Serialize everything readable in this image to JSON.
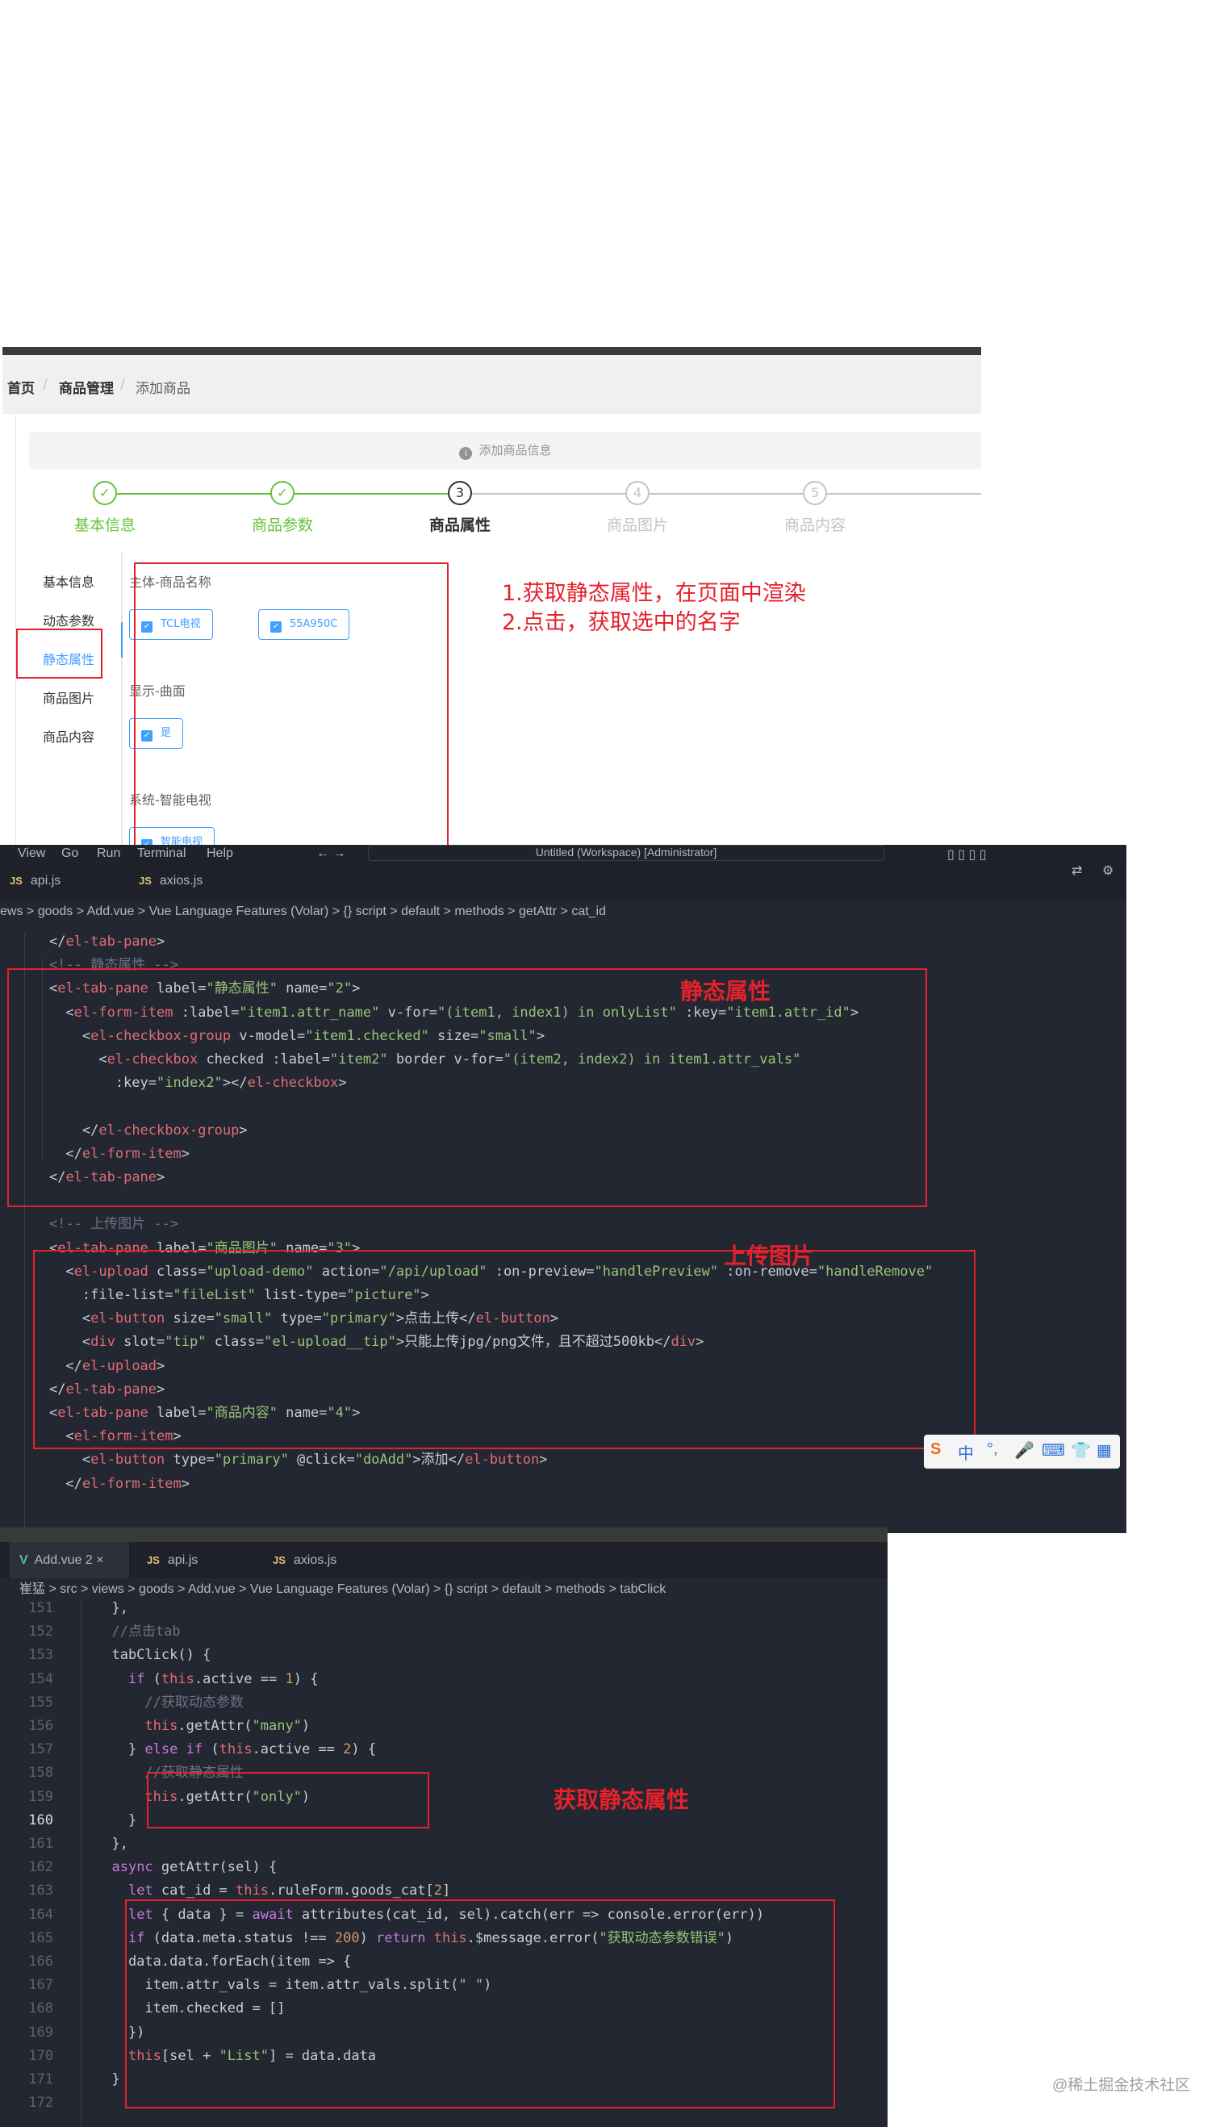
{
  "admin": {
    "breadcrumb": [
      "首页",
      "商品管理",
      "添加商品"
    ],
    "alert": "添加商品信息",
    "steps": [
      {
        "num": "✓",
        "label": "基本信息"
      },
      {
        "num": "✓",
        "label": "商品参数"
      },
      {
        "num": "3",
        "label": "商品属性"
      },
      {
        "num": "4",
        "label": "商品图片"
      },
      {
        "num": "5",
        "label": "商品内容"
      }
    ],
    "side_tabs": [
      "基本信息",
      "动态参数",
      "静态属性",
      "商品图片",
      "商品内容"
    ],
    "groups": [
      {
        "title": "主体-商品名称",
        "options": [
          "TCL电视",
          "55A950C"
        ]
      },
      {
        "title": "显示-曲面",
        "options": [
          "是"
        ]
      },
      {
        "title": "系统-智能电视",
        "options": [
          "智能电视"
        ]
      }
    ],
    "note": [
      "1.获取静态属性，在页面中渲染",
      "2.点击，获取选中的名字"
    ]
  },
  "ide1": {
    "menu": [
      "View",
      "Go",
      "Run",
      "Terminal",
      "Help"
    ],
    "title": "Untitled (Workspace) [Administrator]",
    "tabs": [
      "api.js",
      "axios.js"
    ],
    "breadcrumb": "ews > goods > Add.vue > Vue Language Features (Volar) > {} script > default > methods > getAttr > cat_id",
    "label_static": "静态属性",
    "label_upload": "上传图片",
    "lines": [
      "    </el-tab-pane>",
      "    <!-- 静态属性 -->",
      "    <el-tab-pane label=\"静态属性\" name=\"2\">",
      "      <el-form-item :label=\"item1.attr_name\" v-for=\"(item1, index1) in onlyList\" :key=\"item1.attr_id\">",
      "        <el-checkbox-group v-model=\"item1.checked\" size=\"small\">",
      "          <el-checkbox checked :label=\"item2\" border v-for=\"(item2, index2) in item1.attr_vals\"",
      "            :key=\"index2\"></el-checkbox>",
      "",
      "        </el-checkbox-group>",
      "      </el-form-item>",
      "    </el-tab-pane>",
      "",
      "    <!-- 上传图片 -->",
      "    <el-tab-pane label=\"商品图片\" name=\"3\">",
      "      <el-upload class=\"upload-demo\" action=\"/api/upload\" :on-preview=\"handlePreview\" :on-remove=\"handleRemove\"",
      "        :file-list=\"fileList\" list-type=\"picture\">",
      "        <el-button size=\"small\" type=\"primary\">点击上传</el-button>",
      "        <div slot=\"tip\" class=\"el-upload__tip\">只能上传jpg/png文件，且不超过500kb</div>",
      "      </el-upload>",
      "    </el-tab-pane>",
      "    <el-tab-pane label=\"商品内容\" name=\"4\">",
      "      <el-form-item>",
      "        <el-button type=\"primary\" @click=\"doAdd\">添加</el-button>",
      "      </el-form-item>"
    ]
  },
  "ide2": {
    "tabs": [
      "Add.vue 2",
      "api.js",
      "axios.js"
    ],
    "breadcrumb": "崔猛 > src > views > goods > Add.vue > Vue Language Features (Volar) > {} script > default > methods > tabClick",
    "label": "获取静态属性",
    "line_numbers": [
      "151",
      "152",
      "153",
      "154",
      "155",
      "156",
      "157",
      "158",
      "159",
      "160",
      "161",
      "162",
      "163",
      "164",
      "165",
      "166",
      "167",
      "168",
      "169",
      "170",
      "171",
      "172"
    ],
    "lines": [
      "  },",
      "  //点击tab",
      "  tabClick() {",
      "    if (this.active == 1) {",
      "      //获取动态参数",
      "      this.getAttr(\"many\")",
      "    } else if (this.active == 2) {",
      "      //获取静态属性",
      "      this.getAttr(\"only\")",
      "    }",
      "  },",
      "  async getAttr(sel) {",
      "    let cat_id = this.ruleForm.goods_cat[2]",
      "    let { data } = await attributes(cat_id, sel).catch(err => console.error(err))",
      "    if (data.meta.status !== 200) return this.$message.error(\"获取动态参数错误\")",
      "    data.data.forEach(item => {",
      "      item.attr_vals = item.attr_vals.split(\" \")",
      "      item.checked = []",
      "    })",
      "    this[sel + \"List\"] = data.data",
      "  }",
      ""
    ]
  },
  "ime": {
    "label": "中"
  },
  "watermark": "@稀土掘金技术社区",
  "colors": {
    "accent_red": "#e5212c",
    "primary": "#409eff",
    "success": "#67c23a",
    "editor_bg": "#232731"
  }
}
